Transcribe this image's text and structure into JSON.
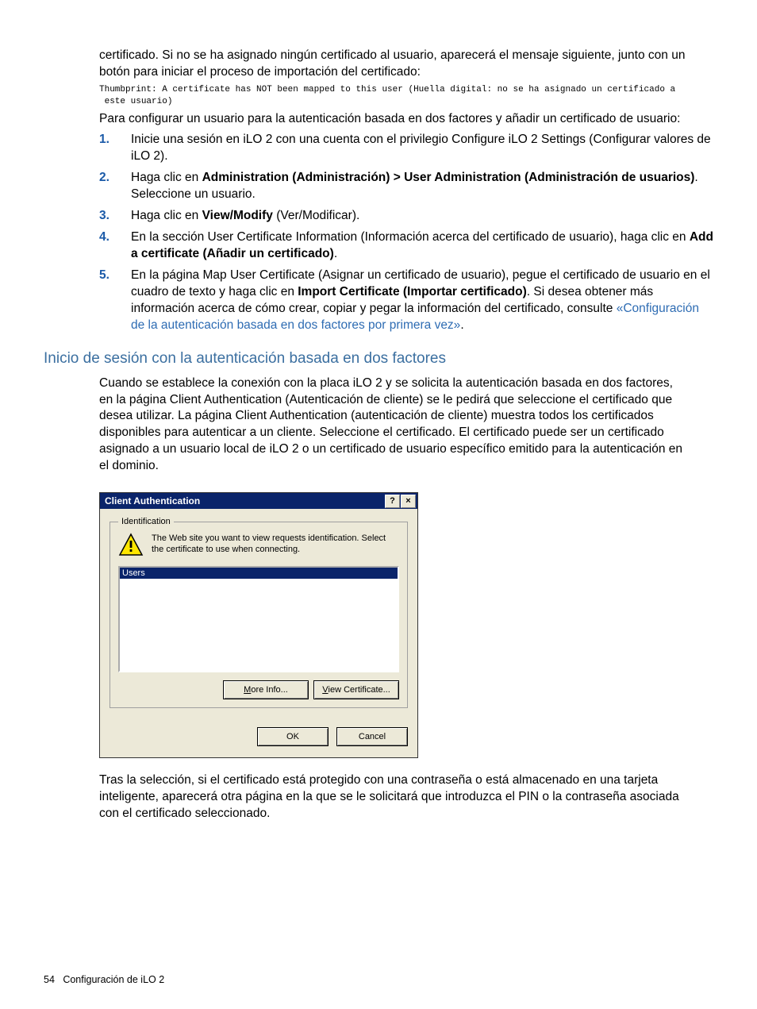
{
  "intro1": "certificado. Si no se ha asignado ningún certificado al usuario, aparecerá el mensaje siguiente, junto con un botón para iniciar el proceso de importación del certificado:",
  "mono_line": "Thumbprint: A certificate has NOT been mapped to this user (Huella digital: no se ha asignado un certificado a\n este usuario)",
  "intro2": "Para configurar un usuario para la autenticación basada en dos factores y añadir un certificado de usuario:",
  "steps": {
    "s1": "Inicie una sesión en iLO 2 con una cuenta con el privilegio Configure iLO 2 Settings (Configurar valores de iLO 2).",
    "s2_a": "Haga clic en ",
    "s2_b": "Administration (Administración) > User Administration (Administración de usuarios)",
    "s2_c": ". Seleccione un usuario.",
    "s3_a": "Haga clic en ",
    "s3_b": "View/Modify",
    "s3_c": " (Ver/Modificar).",
    "s4_a": "En la sección User Certificate Information (Información acerca del certificado de usuario), haga clic en ",
    "s4_b": "Add a certificate (Añadir un certificado)",
    "s4_c": ".",
    "s5_a": "En la página Map User Certificate (Asignar un certificado de usuario), pegue el certificado de usuario en el cuadro de texto y haga clic en ",
    "s5_b": "Import Certificate (Importar certificado)",
    "s5_c": ". Si desea obtener más información acerca de cómo crear, copiar y pegar la información del certificado, consulte ",
    "s5_link": "«Configuración de la autenticación basada en dos factores por primera vez»",
    "s5_d": "."
  },
  "section_heading": "Inicio de sesión con la autenticación basada en dos factores",
  "section_body": "Cuando se establece la conexión con la placa iLO 2 y se solicita la autenticación basada en dos factores, en la página Client Authentication (Autenticación de cliente) se le pedirá que seleccione el certificado que desea utilizar. La página Client Authentication (autenticación de cliente) muestra todos los certificados disponibles para autenticar a un cliente. Seleccione el certificado. El certificado puede ser un certificado asignado a un usuario local de iLO 2 o un certificado de usuario específico emitido para la autenticación en el dominio.",
  "dialog": {
    "title": "Client Authentication",
    "help_glyph": "?",
    "close_glyph": "×",
    "group_legend": "Identification",
    "message": "The Web site you want to view requests identification. Select the certificate to use when connecting.",
    "list_header": "Users",
    "more_info_m": "M",
    "more_info_rest": "ore Info...",
    "view_cert_v": "V",
    "view_cert_rest": "iew Certificate...",
    "ok": "OK",
    "cancel": "Cancel"
  },
  "after_dialog": "Tras la selección, si el certificado está protegido con una contraseña o está almacenado en una tarjeta inteligente, aparecerá otra página en la que se le solicitará que introduzca el PIN o la contraseña asociada con el certificado seleccionado.",
  "footer_page": "54",
  "footer_text": "Configuración de iLO 2"
}
